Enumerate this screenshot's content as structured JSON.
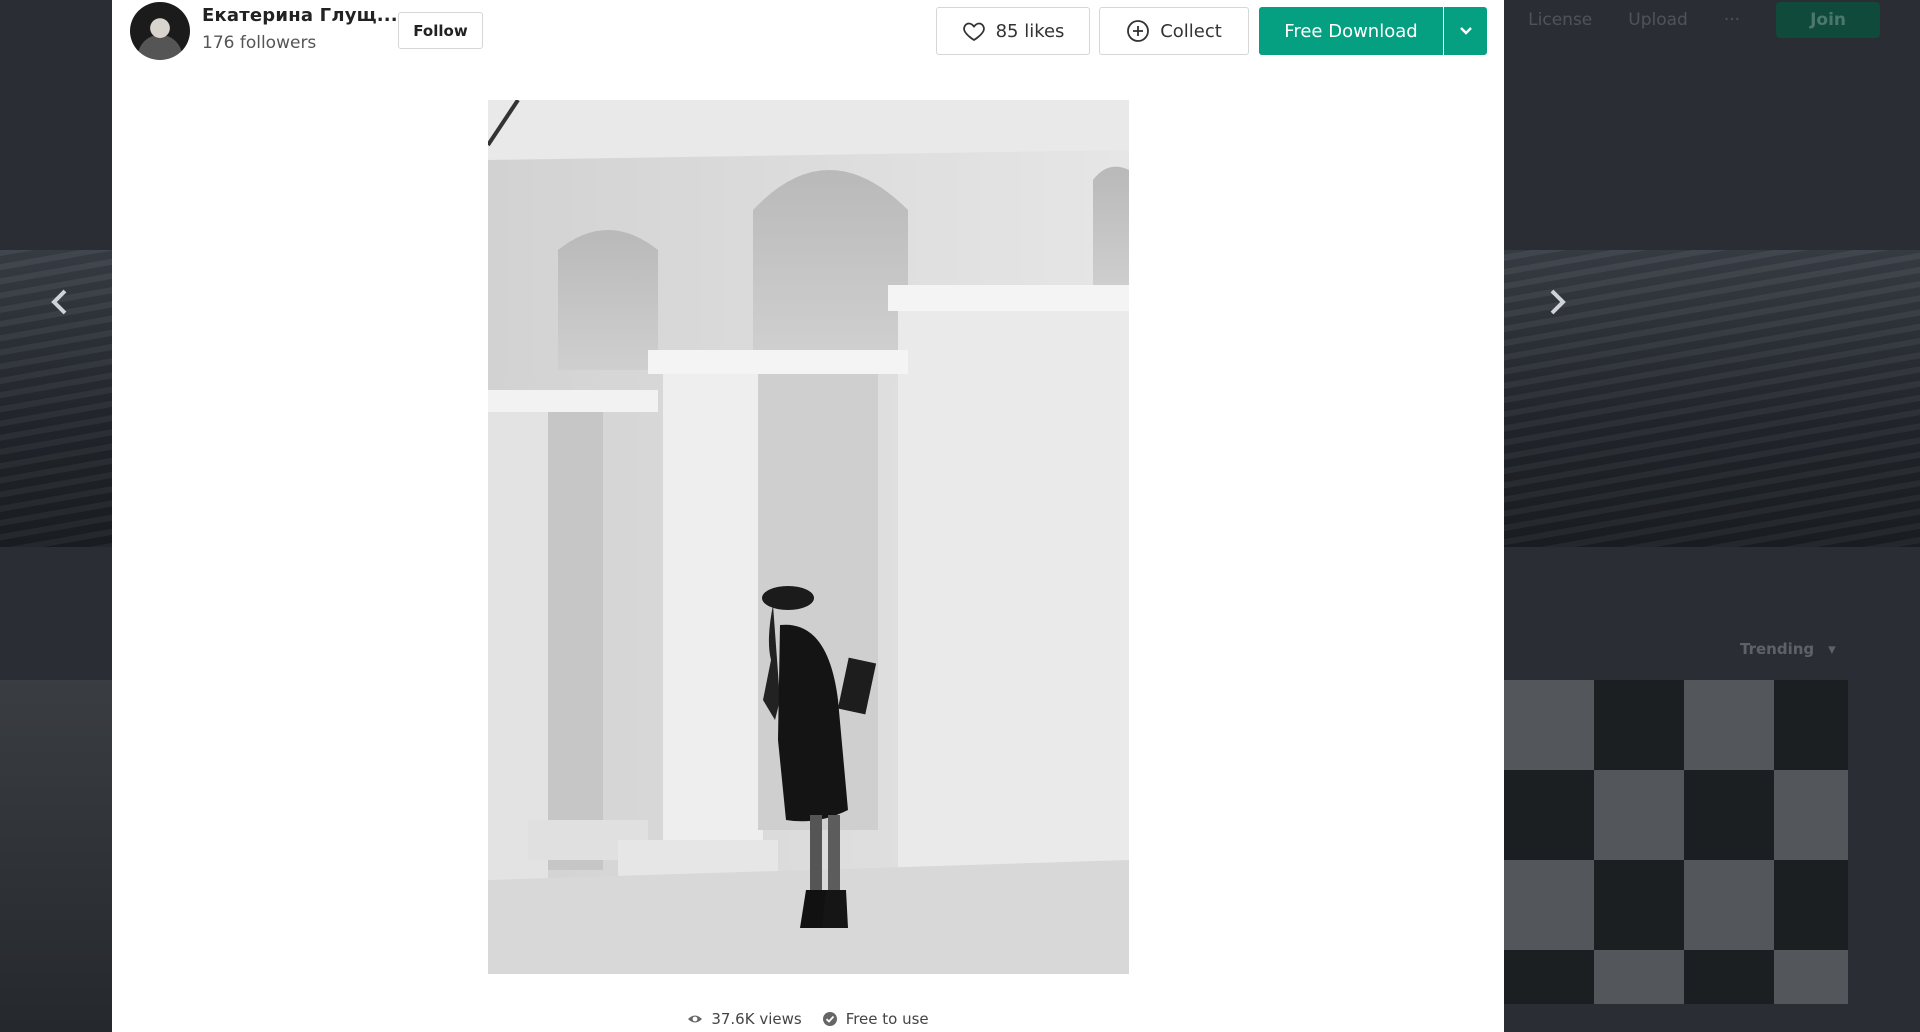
{
  "author": {
    "name": "Екатерина Глущ...",
    "followers": "176 followers",
    "follow_label": "Follow"
  },
  "actions": {
    "likes_label": "85 likes",
    "collect_label": "Collect",
    "download_label": "Free Download"
  },
  "stats": {
    "views": "37.6K views",
    "license": "Free to use"
  },
  "background": {
    "nav": [
      "License",
      "Upload",
      "···"
    ],
    "join_label": "Join",
    "sort_label": "Trending"
  },
  "colors": {
    "accent": "#05a081",
    "overlay_bg": "#2c2f35"
  }
}
